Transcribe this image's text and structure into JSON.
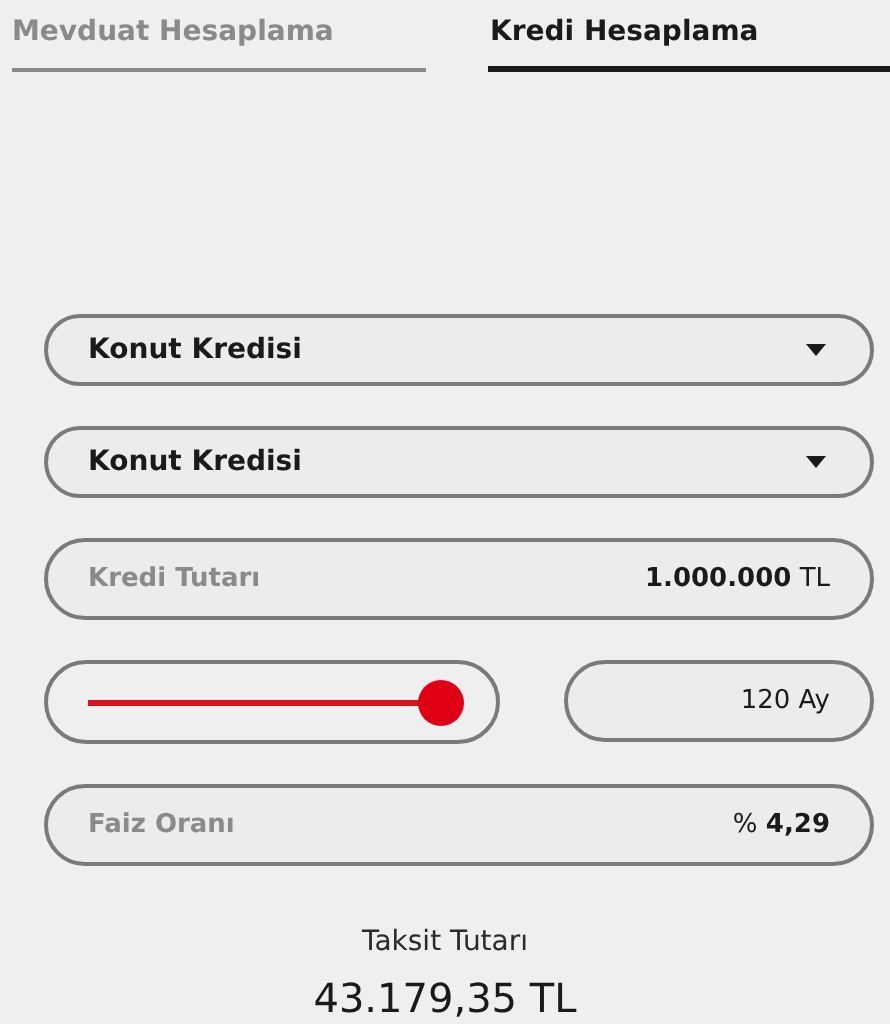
{
  "tabs": [
    {
      "label": "Mevduat Hesaplama",
      "selected": false
    },
    {
      "label": "Kredi Hesaplama",
      "selected": true
    }
  ],
  "selects": [
    {
      "value": "Konut Kredisi"
    },
    {
      "value": "Konut Kredisi"
    }
  ],
  "amount": {
    "label": "Kredi Tutarı",
    "value": "1.000.000",
    "unit": "TL"
  },
  "term": {
    "value": "120",
    "unit": "Ay"
  },
  "rate": {
    "label": "Faiz Oranı",
    "prefix": "%",
    "value": "4,29"
  },
  "result": {
    "label": "Taksit Tutarı",
    "value": "43.179,35 TL"
  }
}
